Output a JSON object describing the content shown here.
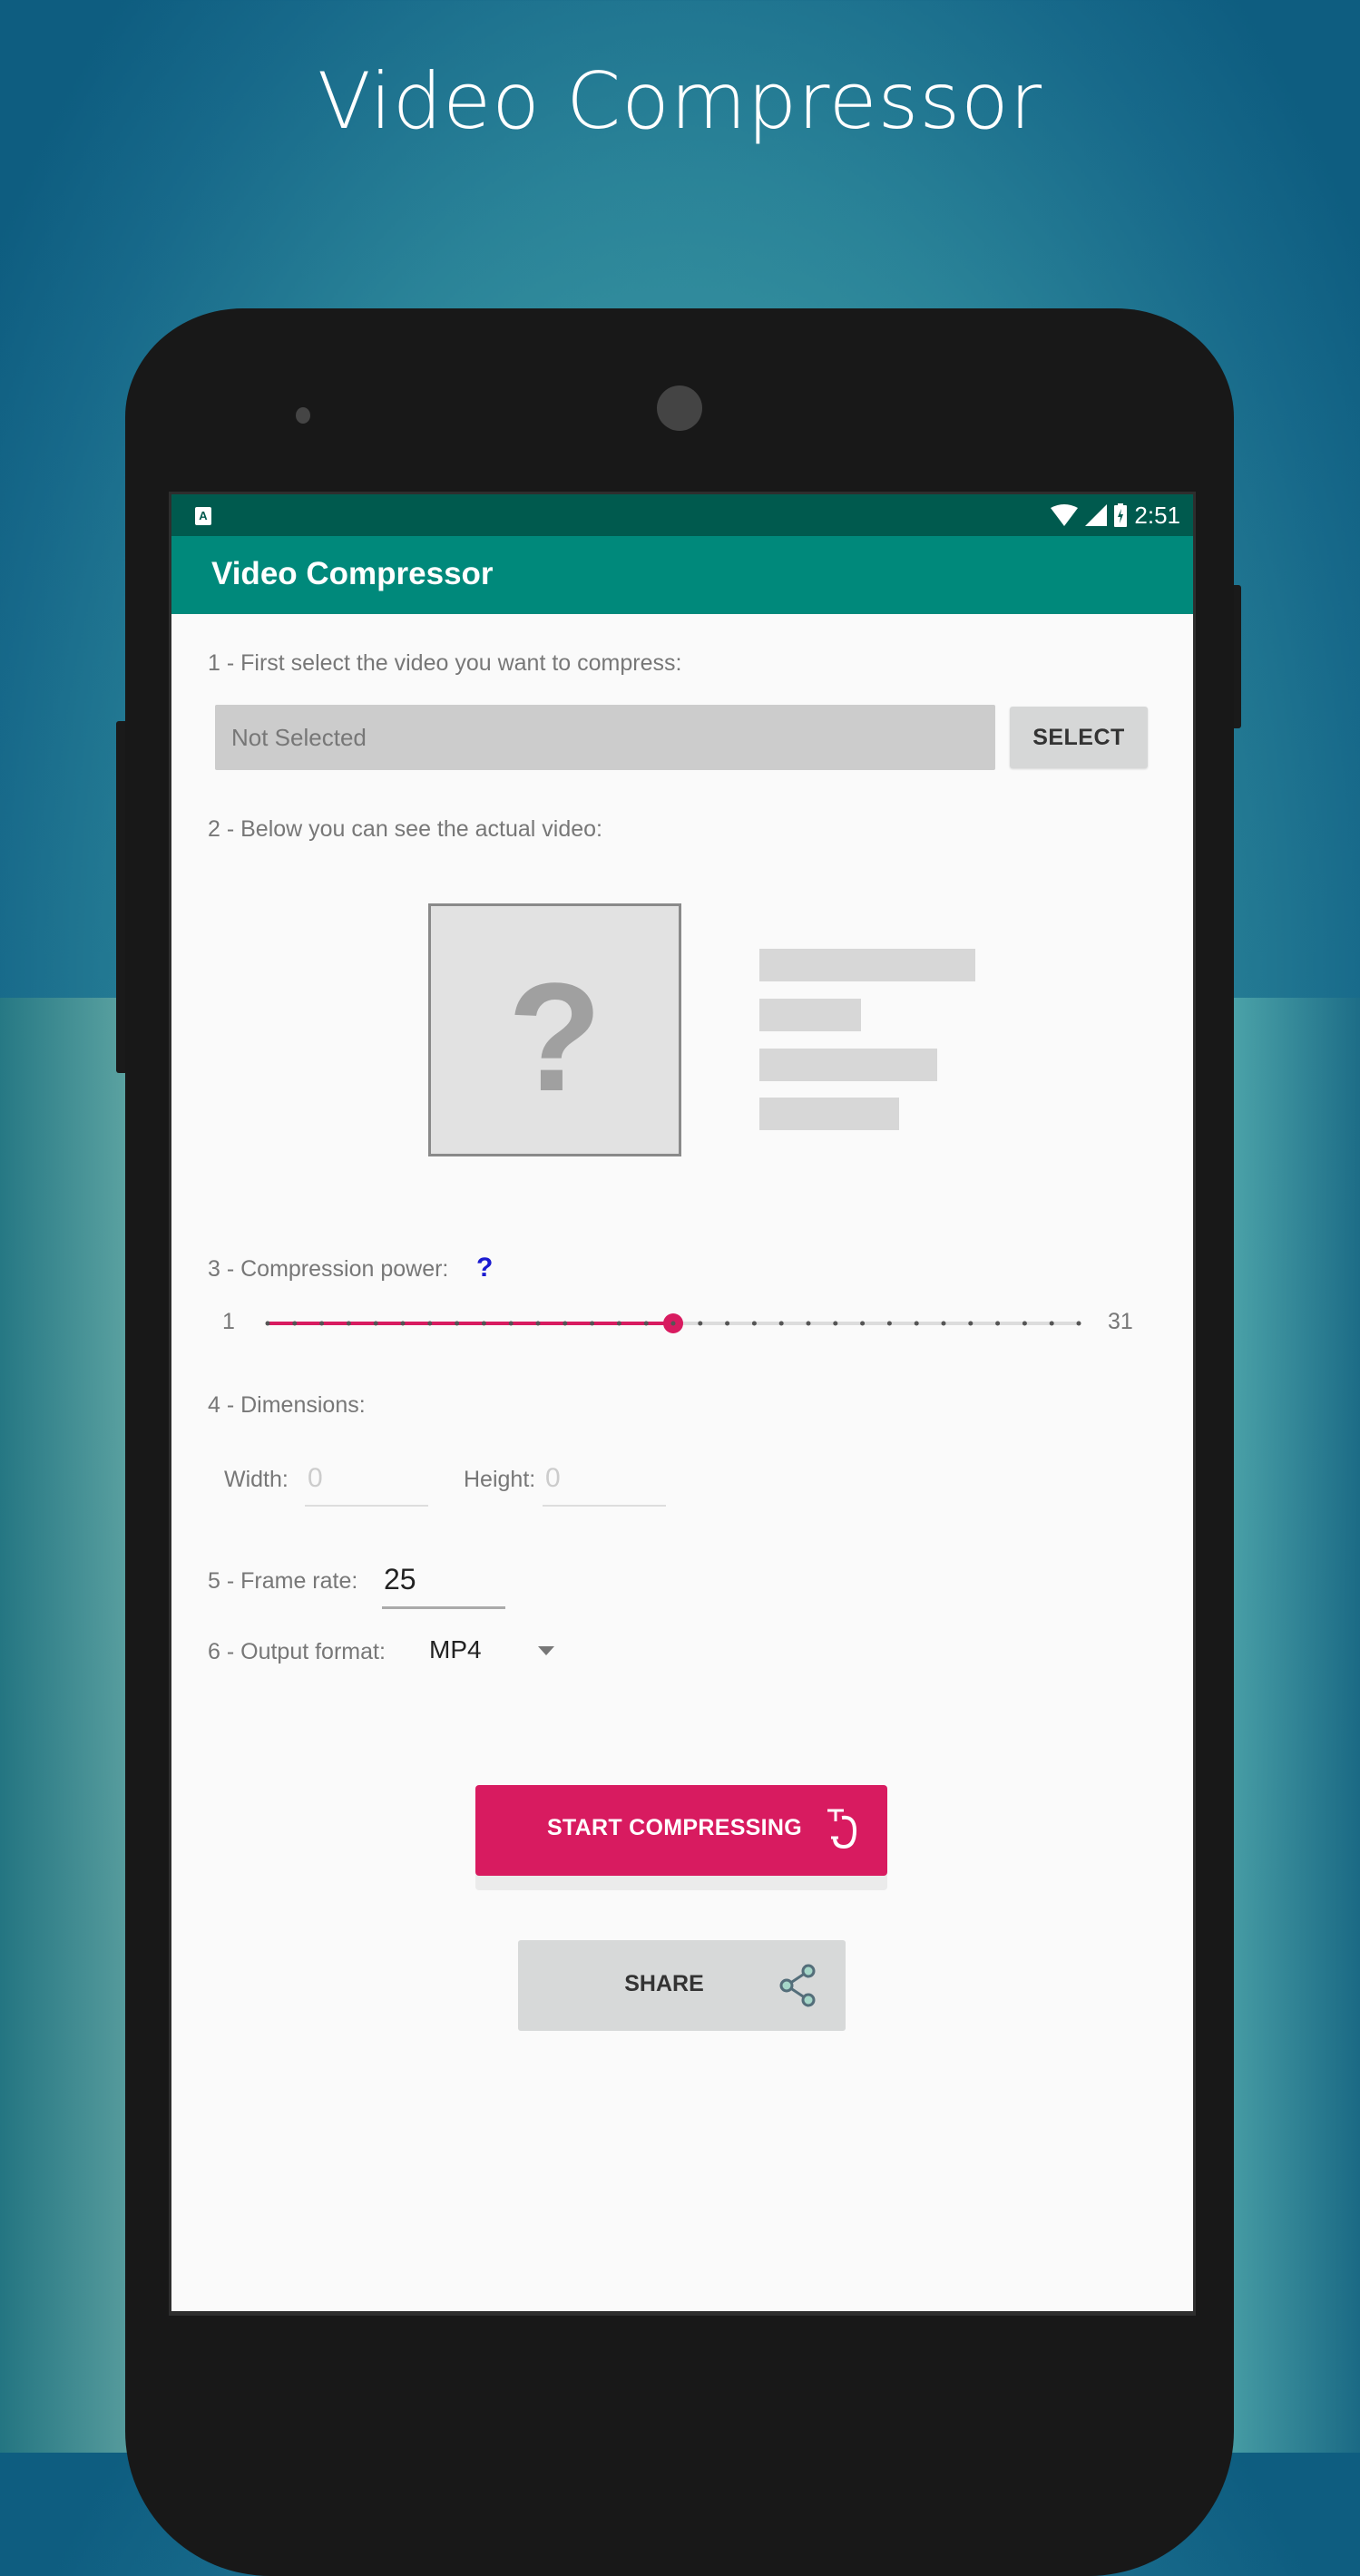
{
  "promo": {
    "title": "Video Compressor"
  },
  "status_bar": {
    "time": "2:51",
    "left_icon": "A",
    "icons": [
      "wifi-icon",
      "signal-icon",
      "battery-charging-icon"
    ]
  },
  "appbar": {
    "title": "Video Compressor"
  },
  "steps": {
    "select": {
      "label": "1 - First select the video you want to compress:",
      "file_value": "Not Selected",
      "button": "SELECT"
    },
    "preview": {
      "label": "2 - Below you can see the actual video:",
      "thumbnail_glyph": "?"
    },
    "compression": {
      "label": "3 - Compression power:",
      "help_glyph": "?",
      "min_label": "1",
      "max_label": "31",
      "min": 1,
      "max": 31,
      "value": 16
    },
    "dimensions": {
      "label": "4 - Dimensions:",
      "width_label": "Width:",
      "width_placeholder": "0",
      "height_label": "Height:",
      "height_placeholder": "0"
    },
    "frame_rate": {
      "label": "5 - Frame rate:",
      "value": "25"
    },
    "output_format": {
      "label": "6 - Output format:",
      "selected": "MP4"
    }
  },
  "actions": {
    "start": "START COMPRESSING",
    "share": "SHARE"
  },
  "colors": {
    "primary": "#00897b",
    "primary_dark": "#005a4e",
    "accent": "#d81b60",
    "help": "#1a1ad0"
  }
}
